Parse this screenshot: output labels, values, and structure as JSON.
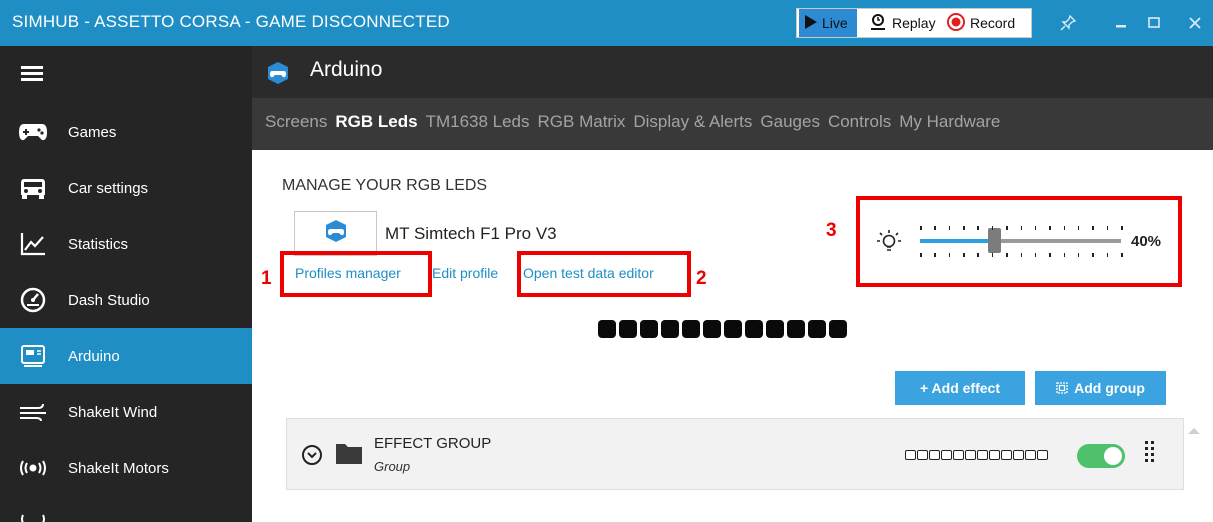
{
  "titlebar": {
    "title": "SIMHUB - ASSETTO CORSA - GAME DISCONNECTED",
    "modes": [
      {
        "label": "Live",
        "icon": "play-icon"
      },
      {
        "label": "Replay",
        "icon": "replay-icon"
      },
      {
        "label": "Record",
        "icon": "record-icon"
      }
    ],
    "controls": [
      "pin-icon",
      "minimize-icon",
      "maximize-icon",
      "close-icon"
    ]
  },
  "sidebar": {
    "items": [
      {
        "label": "Games",
        "icon": "gamepad-icon"
      },
      {
        "label": "Car settings",
        "icon": "car-icon"
      },
      {
        "label": "Statistics",
        "icon": "chart-icon"
      },
      {
        "label": "Dash Studio",
        "icon": "gauge-icon"
      },
      {
        "label": "Arduino",
        "icon": "arduino-icon",
        "active": true
      },
      {
        "label": "ShakeIt Wind",
        "icon": "wind-icon"
      },
      {
        "label": "ShakeIt Motors",
        "icon": "vibration-icon"
      }
    ]
  },
  "module": {
    "title": "Arduino"
  },
  "tabs": [
    "Screens",
    "RGB Leds",
    "TM1638 Leds",
    "RGB Matrix",
    "Display & Alerts",
    "Gauges",
    "Controls",
    "My Hardware"
  ],
  "active_tab": "RGB Leds",
  "content": {
    "heading": "MANAGE YOUR RGB LEDS",
    "device_name": "MT Simtech F1 Pro V3",
    "links": {
      "profiles_manager": "Profiles manager",
      "edit_profile": "Edit profile",
      "open_test_data_editor": "Open test data editor"
    },
    "annotations": {
      "a1": "1",
      "a2": "2",
      "a3": "3"
    },
    "brightness": {
      "value": 40,
      "label": "40%"
    },
    "led_count": 12,
    "buttons": {
      "add_effect": "+ Add effect",
      "add_group": "Add group"
    },
    "effect_group": {
      "name": "EFFECT GROUP",
      "type": "Group",
      "enabled": true
    }
  },
  "colors": {
    "accent": "#1e8ec5",
    "sidebar_bg": "#252526",
    "annotation_red": "#ee0000",
    "toggle_on": "#4fc06b"
  }
}
